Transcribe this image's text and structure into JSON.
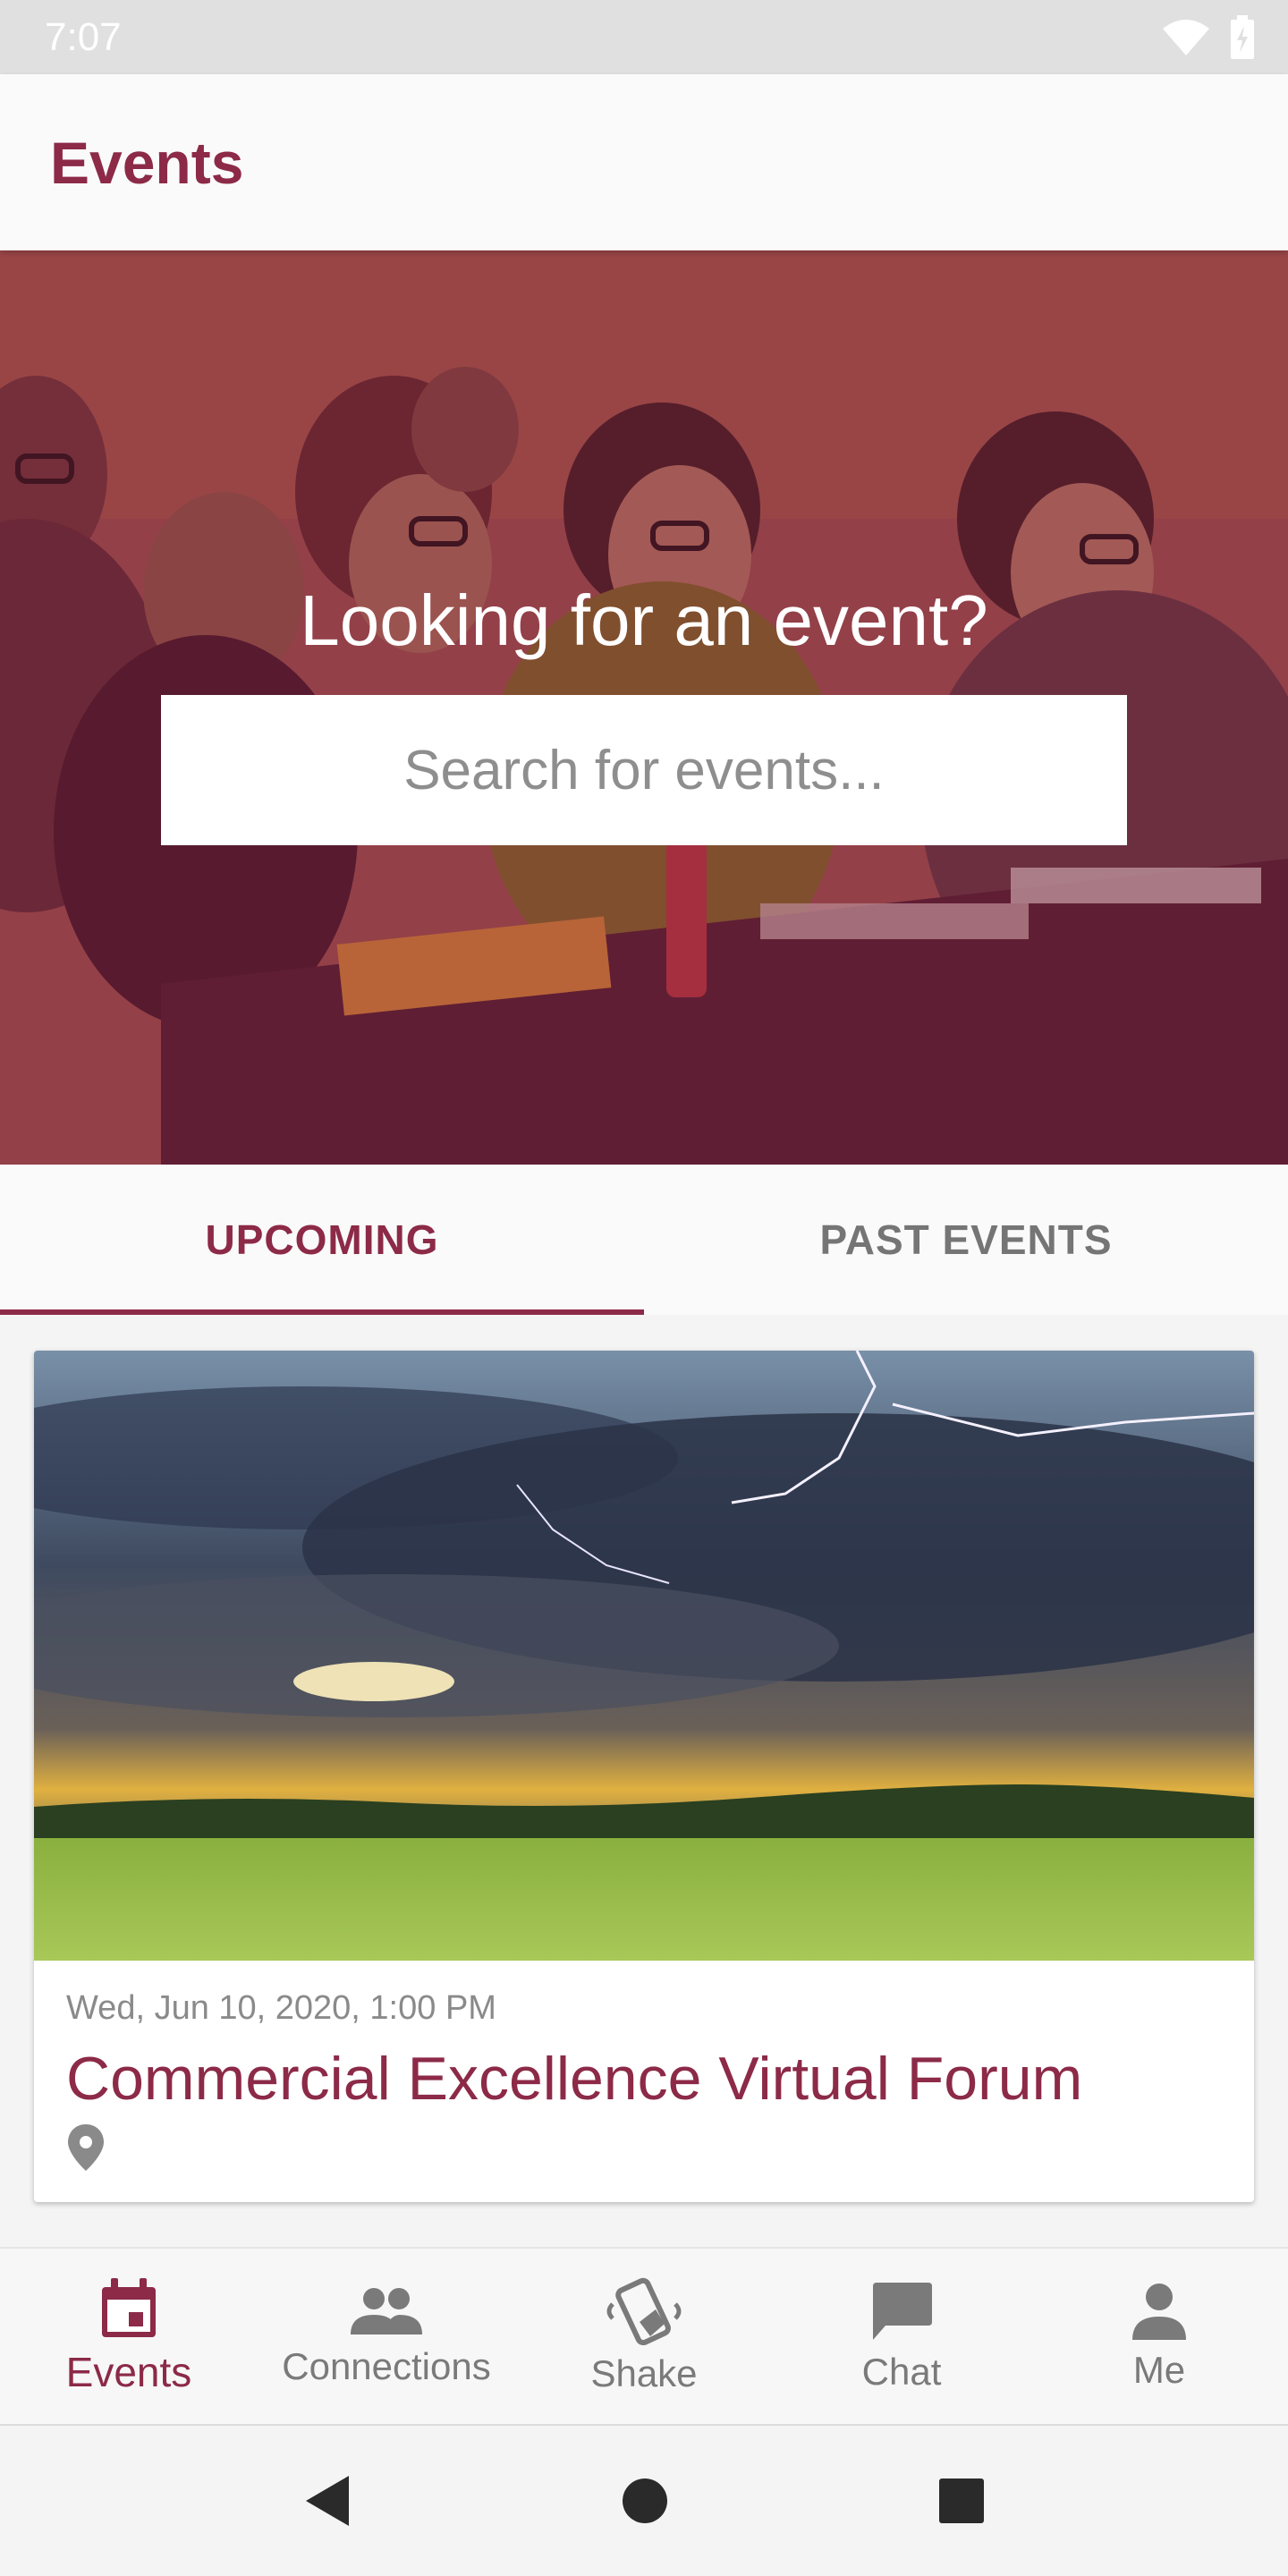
{
  "status_bar": {
    "time": "7:07",
    "icons": [
      "wifi-icon",
      "battery-icon"
    ]
  },
  "app_bar": {
    "title": "Events"
  },
  "hero": {
    "heading": "Looking for an event?",
    "search_placeholder": "Search for events..."
  },
  "tabs": [
    {
      "label": "UPCOMING",
      "active": true
    },
    {
      "label": "PAST EVENTS",
      "active": false
    }
  ],
  "events": [
    {
      "date": "Wed, Jun 10, 2020, 1:00 PM",
      "title": "Commercial Excellence Virtual Forum",
      "location_icon": "location-pin-icon"
    }
  ],
  "bottom_nav": [
    {
      "label": "Events",
      "icon": "calendar-icon",
      "active": true
    },
    {
      "label": "Connections",
      "icon": "people-icon",
      "active": false
    },
    {
      "label": "Shake",
      "icon": "shake-phone-icon",
      "active": false
    },
    {
      "label": "Chat",
      "icon": "chat-bubble-icon",
      "active": false
    },
    {
      "label": "Me",
      "icon": "person-icon",
      "active": false
    }
  ],
  "system_nav": [
    "back-icon",
    "home-icon",
    "recents-icon"
  ],
  "colors": {
    "brand": "#8c2a48",
    "inactive": "#757575",
    "background": "#f4f4f4"
  }
}
